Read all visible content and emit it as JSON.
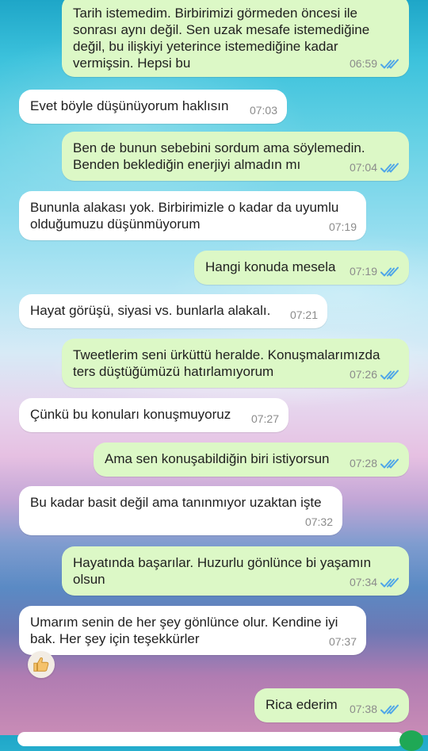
{
  "messages": [
    {
      "text": "Tarih istemedim. Birbirimizi görmeden öncesi ile sonrası aynı değil. Sen uzak mesafe istemediğine değil, bu ilişkiyi yeterince istemediğine kadar vermişsin. Hepsi bu",
      "time": "06:59",
      "direction": "outgoing",
      "read": true
    },
    {
      "text": "Evet böyle düşünüyorum haklısın",
      "time": "07:03",
      "direction": "incoming"
    },
    {
      "text": "Ben de bunun sebebini sordum ama söylemedin. Benden beklediğin enerjiyi almadın mı",
      "time": "07:04",
      "direction": "outgoing",
      "read": true
    },
    {
      "text": "Bununla alakası yok. Birbirimizle o kadar da uyumlu olduğumuzu düşünmüyorum",
      "time": "07:19",
      "direction": "incoming"
    },
    {
      "text": "Hangi konuda mesela",
      "time": "07:19",
      "direction": "outgoing",
      "read": true
    },
    {
      "text": "Hayat görüşü, siyasi vs. bunlarla alakalı.",
      "time": "07:21",
      "direction": "incoming"
    },
    {
      "text": "Tweetlerim seni ürküttü heralde. Konuşmalarımızda ters düştüğümüzü hatırlamıyorum",
      "time": "07:26",
      "direction": "outgoing",
      "read": true
    },
    {
      "text": "Çünkü bu konuları konuşmuyoruz",
      "time": "07:27",
      "direction": "incoming"
    },
    {
      "text": "Ama sen konuşabildiğin biri istiyorsun",
      "time": "07:28",
      "direction": "outgoing",
      "read": true
    },
    {
      "text": "Bu kadar basit değil ama tanınmıyor uzaktan işte",
      "time": "07:32",
      "direction": "incoming"
    },
    {
      "text": "Hayatında başarılar. Huzurlu gönlünce bi yaşamın olsun",
      "time": "07:34",
      "direction": "outgoing",
      "read": true
    },
    {
      "text": "Umarım senin de her şey gönlünce olur. Kendine iyi bak. Her şey için teşekkürler",
      "time": "07:37",
      "direction": "incoming",
      "reaction": "thumbs-up-icon"
    },
    {
      "text": "Rica ederim",
      "time": "07:38",
      "direction": "outgoing",
      "read": true
    }
  ],
  "colors": {
    "outgoing_bubble": "#dcf8c6",
    "incoming_bubble": "#ffffff",
    "read_ticks": "#4fa6e8",
    "timestamp": "#8b8b8b"
  }
}
